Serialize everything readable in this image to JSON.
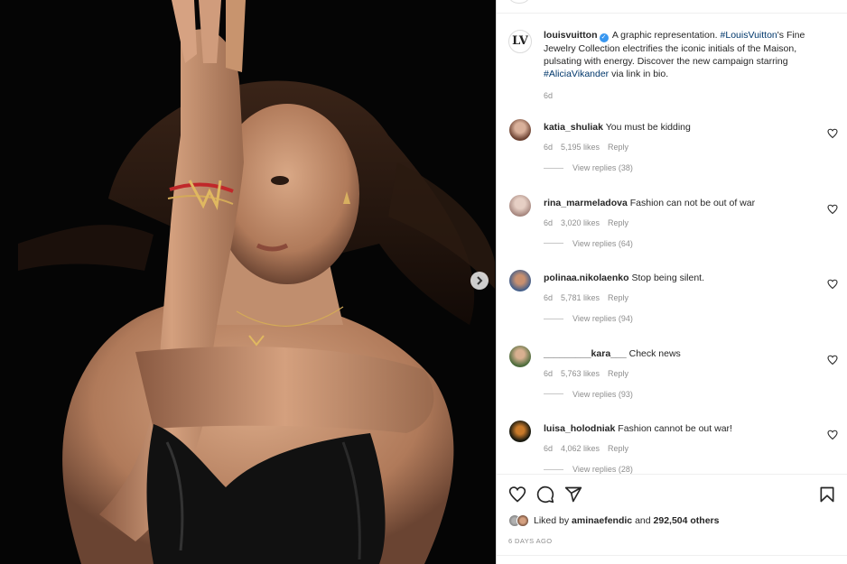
{
  "post": {
    "author": "louisvuitton",
    "caption_pre": "A graphic representation.",
    "caption_tag1": "#LouisVuitton",
    "caption_mid": "'s Fine Jewelry Collection electrifies the iconic initials of the Maison, pulsating with energy. Discover the new campaign starring",
    "caption_tag2": "#AliciaVikander",
    "caption_post": "via link in bio.",
    "age": "6d",
    "logo_text": "LV"
  },
  "comments": [
    {
      "user": "katia_shuliak",
      "text": "You must be kidding",
      "age": "6d",
      "likes": "5,195 likes",
      "reply": "Reply",
      "replies": "View replies (38)",
      "avatar_color": "#7a5a4a"
    },
    {
      "user": "rina_marmeladova",
      "text": "Fashion can not be out of war",
      "age": "6d",
      "likes": "3,020 likes",
      "reply": "Reply",
      "replies": "View replies (64)",
      "avatar_color": "#c9a89a"
    },
    {
      "user": "polinaa.nikolaenko",
      "text": "Stop being silent.",
      "age": "6d",
      "likes": "5,781 likes",
      "reply": "Reply",
      "replies": "View replies (94)",
      "avatar_color": "#4a6a9a"
    },
    {
      "user": "_________kara___",
      "text": "Check news",
      "age": "6d",
      "likes": "5,763 likes",
      "reply": "Reply",
      "replies": "View replies (93)",
      "avatar_color": "#5a7a4a"
    },
    {
      "user": "luisa_holodniak",
      "text": "Fashion cannot be out war!",
      "age": "6d",
      "likes": "4,062 likes",
      "reply": "Reply",
      "replies": "View replies (28)",
      "avatar_color": "#2a2a1a"
    }
  ],
  "likes": {
    "prefix": "Liked by",
    "user": "aminaefendic",
    "and": "and",
    "count": "292,504 others"
  },
  "time_ago": "6 DAYS AGO",
  "icons": [
    "heart-icon",
    "comment-icon",
    "share-icon",
    "bookmark-icon",
    "chevron-right-icon",
    "verified-badge-icon"
  ],
  "colors": {
    "link": "#00376b",
    "verified": "#3897f0",
    "muted": "#8e8e8e"
  }
}
